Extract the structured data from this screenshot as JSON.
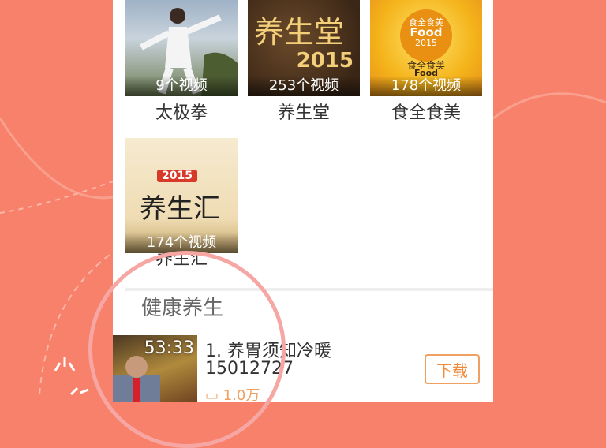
{
  "categories": [
    {
      "title": "太极拳",
      "count": "9个视频"
    },
    {
      "title": "养生堂",
      "count": "253个视频"
    },
    {
      "title": "食全食美",
      "count": "178个视频"
    },
    {
      "title": "养生汇",
      "count": "174个视频"
    }
  ],
  "thumb_text": {
    "yst_title": "养生堂",
    "yst_year": "2015",
    "qsqm_l1": "食全食美",
    "qsqm_l2": "Food",
    "qsqm_l3": "2015",
    "qsqm_l4": "食全食美",
    "qsqm_l5": "Food",
    "ysh_year": "2015",
    "ysh_title": "养生汇"
  },
  "section": {
    "title": "健康养生"
  },
  "video": {
    "duration": "53:33",
    "title": "1. 养胃须知冷暖",
    "views": "15012727",
    "comments": "1.0万",
    "download_label": "下载"
  },
  "colors": {
    "background": "#f7816b",
    "accent": "#f08a3c",
    "circle": "#f6a7a4"
  }
}
